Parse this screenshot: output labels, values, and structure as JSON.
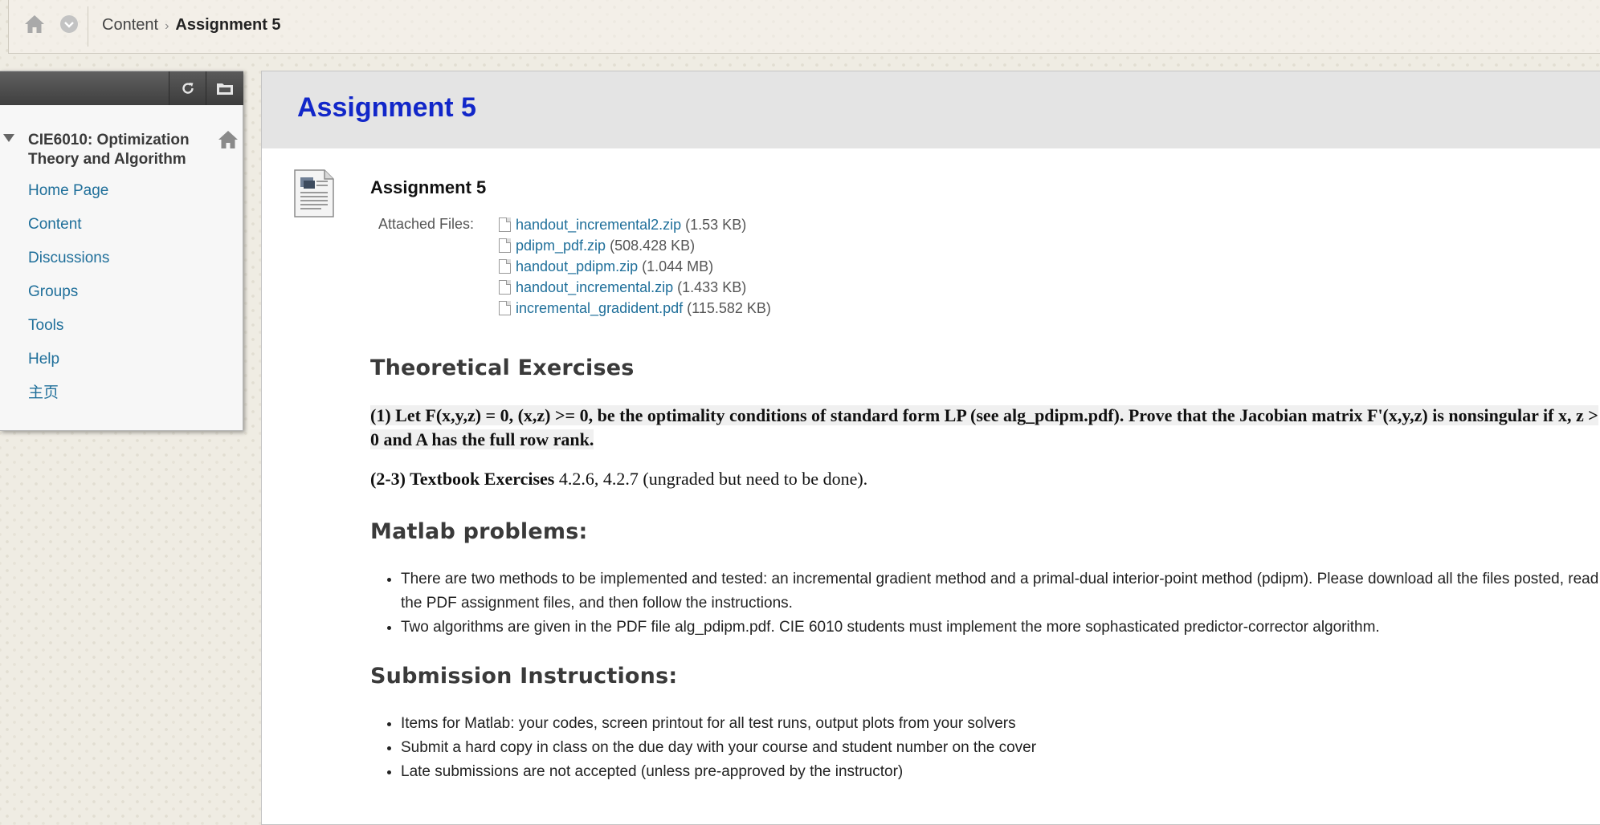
{
  "breadcrumb": {
    "items": [
      "Content",
      "Assignment 5"
    ]
  },
  "course_menu": {
    "title": "CIE6010: Optimization Theory and Algorithm",
    "links": [
      "Home Page",
      "Content",
      "Discussions",
      "Groups",
      "Tools",
      "Help",
      "主页"
    ]
  },
  "content": {
    "page_title": "Assignment 5",
    "item_title": "Assignment 5",
    "attached_label": "Attached Files:",
    "files": [
      {
        "name": "handout_incremental2.zip",
        "size": "(1.53 KB)"
      },
      {
        "name": "pdipm_pdf.zip",
        "size": "(508.428 KB)"
      },
      {
        "name": "handout_pdipm.zip",
        "size": "(1.044 MB)"
      },
      {
        "name": "handout_incremental.zip",
        "size": "(1.433 KB)"
      },
      {
        "name": "incremental_gradident.pdf",
        "size": "(115.582 KB)"
      }
    ],
    "theoretical_heading": "Theoretical Exercises",
    "exercise1": "(1) Let F(x,y,z) = 0, (x,z) >= 0, be the optimality conditions of standard form LP (see alg_pdipm.pdf). Prove that the Jacobian matrix F'(x,y,z) is nonsingular if x, z > 0 and A has the full row rank.",
    "exercise23_bold": "(2-3) Textbook Exercises",
    "exercise23_rest": " 4.2.6, 4.2.7 (ungraded but need to be done).",
    "matlab_heading": "Matlab problems:",
    "matlab_items": [
      "There are two methods to be implemented and tested: an incremental gradient method and a primal-dual interior-point method (pdipm).  Please download all the files posted, read the PDF assignment files, and then follow the instructions.",
      "Two algorithms are given in the PDF file alg_pdipm.pdf.  CIE 6010 students must implement the more sophasticated predictor-corrector algorithm."
    ],
    "submission_heading": "Submission Instructions:",
    "submission_items": [
      "Items for Matlab: your codes, screen printout for all test runs, output plots from your solvers",
      "Submit a hard copy in class on the due day with your course and student number on the cover",
      "Late submissions are not accepted (unless pre-approved by the instructor)"
    ]
  },
  "colors": {
    "title_blue": "#1227c9",
    "link_blue": "#1f6f9a",
    "toolbar_dark": "#4a4a4a"
  },
  "icons": [
    "home-icon",
    "chevron-down-icon",
    "refresh-icon",
    "folder-icon",
    "document-icon",
    "file-icon"
  ]
}
